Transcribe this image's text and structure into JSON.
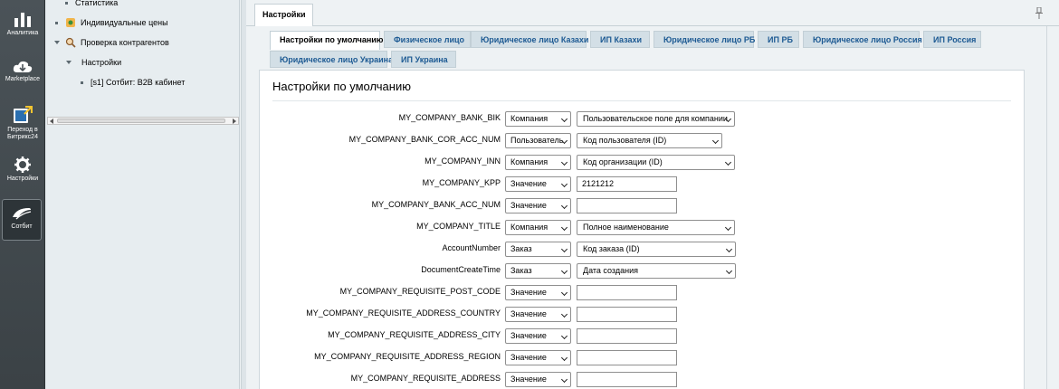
{
  "left_menu": {
    "items": [
      {
        "label": "Аналитика",
        "icon": "chart-icon"
      },
      {
        "label": "Marketplace",
        "icon": "cloud-icon"
      },
      {
        "label": "Переход в Битрикс24",
        "icon": "b24-icon"
      },
      {
        "label": "Настройки",
        "icon": "gear-icon"
      },
      {
        "label": "Сотбит",
        "icon": "sotbit-icon"
      }
    ]
  },
  "tree": {
    "items": [
      {
        "label": "Статистика"
      },
      {
        "label": "Индивидуальные цены"
      },
      {
        "label": "Проверка контрагентов"
      },
      {
        "label": "Настройки"
      },
      {
        "label": "[s1] Сотбит: B2B кабинет"
      }
    ]
  },
  "header": {
    "tab_label": "Настройки"
  },
  "tabs": [
    {
      "label": "Настройки по умолчанию"
    },
    {
      "label": "Физическое лицо"
    },
    {
      "label": "Юридическое лицо Казахи"
    },
    {
      "label": "ИП Казахи"
    },
    {
      "label": "Юридическое лицо РБ"
    },
    {
      "label": "ИП РБ"
    },
    {
      "label": "Юридическое лицо Россия"
    },
    {
      "label": "ИП Россия"
    },
    {
      "label": "Юридическое лицо Украина"
    },
    {
      "label": "ИП Украина"
    }
  ],
  "panel": {
    "title": "Настройки по умолчанию",
    "rows": [
      {
        "label": "MY_COMPANY_BANK_BIK",
        "type": "Компания",
        "value": "Пользовательское поле для компании"
      },
      {
        "label": "MY_COMPANY_BANK_COR_ACC_NUM",
        "type": "Пользователь",
        "value": "Код пользователя (ID)"
      },
      {
        "label": "MY_COMPANY_INN",
        "type": "Компания",
        "value": "Код организации (ID)"
      },
      {
        "label": "MY_COMPANY_KPP",
        "type": "Значение",
        "value": "2121212"
      },
      {
        "label": "MY_COMPANY_BANK_ACC_NUM",
        "type": "Значение",
        "value": ""
      },
      {
        "label": "MY_COMPANY_TITLE",
        "type": "Компания",
        "value": "Полное наименование"
      },
      {
        "label": "AccountNumber",
        "type": "Заказ",
        "value": "Код заказа (ID)"
      },
      {
        "label": "DocumentCreateTime",
        "type": "Заказ",
        "value": "Дата создания"
      },
      {
        "label": "MY_COMPANY_REQUISITE_POST_CODE",
        "type": "Значение",
        "value": ""
      },
      {
        "label": "MY_COMPANY_REQUISITE_ADDRESS_COUNTRY",
        "type": "Значение",
        "value": ""
      },
      {
        "label": "MY_COMPANY_REQUISITE_ADDRESS_CITY",
        "type": "Значение",
        "value": ""
      },
      {
        "label": "MY_COMPANY_REQUISITE_ADDRESS_REGION",
        "type": "Значение",
        "value": ""
      },
      {
        "label": "MY_COMPANY_REQUISITE_ADDRESS",
        "type": "Значение",
        "value": ""
      }
    ]
  }
}
